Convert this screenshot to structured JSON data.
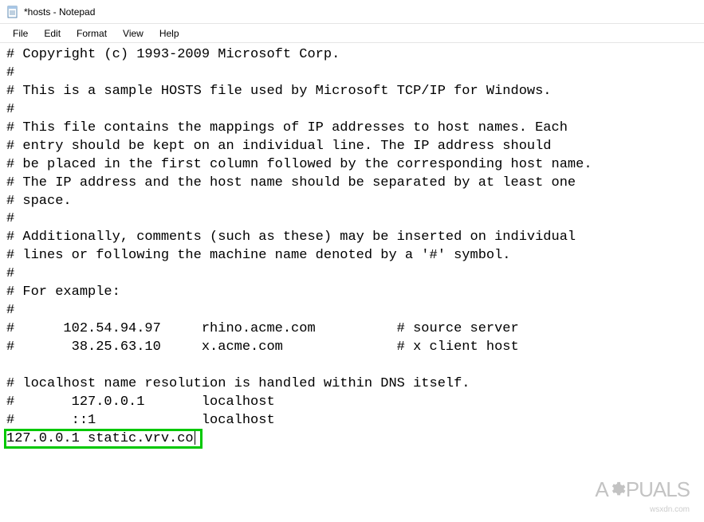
{
  "window": {
    "title": "*hosts - Notepad"
  },
  "menu": {
    "items": [
      "File",
      "Edit",
      "Format",
      "View",
      "Help"
    ]
  },
  "editor": {
    "lines": [
      "# Copyright (c) 1993-2009 Microsoft Corp.",
      "#",
      "# This is a sample HOSTS file used by Microsoft TCP/IP for Windows.",
      "#",
      "# This file contains the mappings of IP addresses to host names. Each",
      "# entry should be kept on an individual line. The IP address should",
      "# be placed in the first column followed by the corresponding host name.",
      "# The IP address and the host name should be separated by at least one",
      "# space.",
      "#",
      "# Additionally, comments (such as these) may be inserted on individual",
      "# lines or following the machine name denoted by a '#' symbol.",
      "#",
      "# For example:",
      "#",
      "#      102.54.94.97     rhino.acme.com          # source server",
      "#       38.25.63.10     x.acme.com              # x client host",
      "",
      "# localhost name resolution is handled within DNS itself.",
      "#       127.0.0.1       localhost",
      "#       ::1             localhost",
      "127.0.0.1 static.vrv.co"
    ],
    "highlighted_line_index": 21
  },
  "watermark": {
    "brand_pre": "A",
    "brand_post": "PUALS",
    "sub": "wsxdn.com"
  }
}
